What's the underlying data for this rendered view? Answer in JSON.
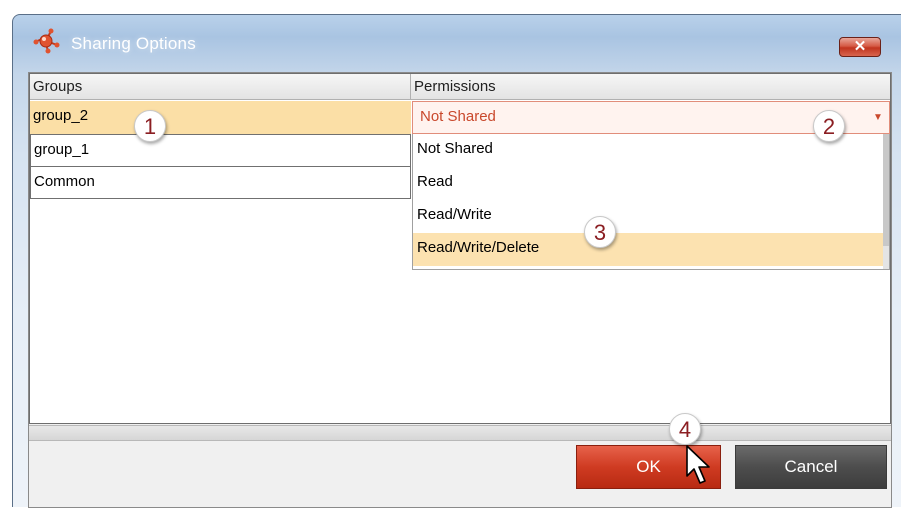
{
  "window": {
    "title": "Sharing Options",
    "close_glyph": "✕",
    "app_icon": "molecule-icon"
  },
  "table": {
    "columns": [
      "Groups",
      "Permissions"
    ],
    "rows": [
      {
        "group": "group_2",
        "permission": "Not Shared",
        "selected": true
      },
      {
        "group": "group_1"
      },
      {
        "group": "Common"
      }
    ]
  },
  "permission_dropdown": {
    "current": "Not Shared",
    "options": [
      "Not Shared",
      "Read",
      "Read/Write",
      "Read/Write/Delete"
    ],
    "highlighted": "Read/Write/Delete"
  },
  "buttons": {
    "ok": "OK",
    "cancel": "Cancel"
  },
  "callouts": [
    "1",
    "2",
    "3",
    "4"
  ],
  "colors": {
    "selection": "#fbdfa6",
    "accent_red": "#cf3b22",
    "callout_text": "#8b1e22"
  }
}
